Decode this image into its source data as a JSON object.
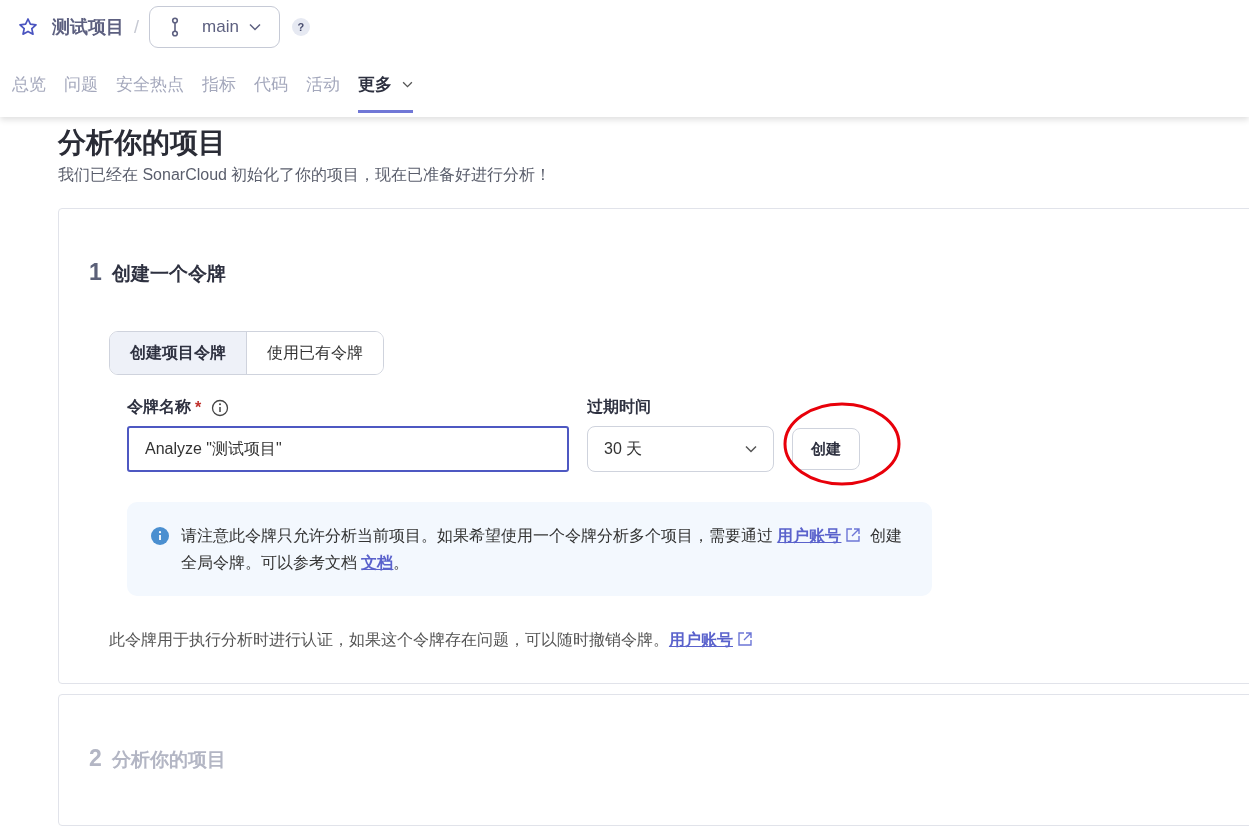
{
  "header": {
    "project_name": "测试项目",
    "separator": "/",
    "branch": "main",
    "help": "?"
  },
  "nav": [
    {
      "label": "总览",
      "selected": false
    },
    {
      "label": "问题",
      "selected": false
    },
    {
      "label": "安全热点",
      "selected": false
    },
    {
      "label": "指标",
      "selected": false
    },
    {
      "label": "代码",
      "selected": false
    },
    {
      "label": "活动",
      "selected": false
    },
    {
      "label": "更多",
      "selected": true,
      "dropdown": true
    }
  ],
  "page": {
    "title": "分析你的项目",
    "subtitle": "我们已经在 SonarCloud 初始化了你的项目，现在已准备好进行分析！"
  },
  "steps": [
    {
      "number": "1",
      "title": "创建一个令牌",
      "active": true
    },
    {
      "number": "2",
      "title": "分析你的项目",
      "active": false
    }
  ],
  "token_form": {
    "tabs": [
      {
        "label": "创建项目令牌",
        "selected": true
      },
      {
        "label": "使用已有令牌",
        "selected": false
      }
    ],
    "name_label": "令牌名称",
    "required_mark": "*",
    "name_value": "Analyze \"测试项目\"",
    "expiry_label": "过期时间",
    "expiry_value": "30 天",
    "create_button": "创建",
    "annotation_circle": true,
    "info_note": [
      {
        "kind": "text",
        "text": "请注意此令牌只允许分析当前项目。如果希望使用一个令牌分析多个项目，需要通过 "
      },
      {
        "kind": "link",
        "text": "用户账号",
        "external": true
      },
      {
        "kind": "text",
        "text": " 创建全局令牌。可以参考文档 "
      },
      {
        "kind": "link",
        "text": "文档",
        "external": false
      },
      {
        "kind": "text",
        "text": "。"
      }
    ],
    "footer_note": [
      {
        "kind": "text",
        "text": "此令牌用于执行分析时进行认证，如果这个令牌存在问题，可以随时撤销令牌。"
      },
      {
        "kind": "link",
        "text": "用户账号",
        "external": true
      }
    ]
  }
}
